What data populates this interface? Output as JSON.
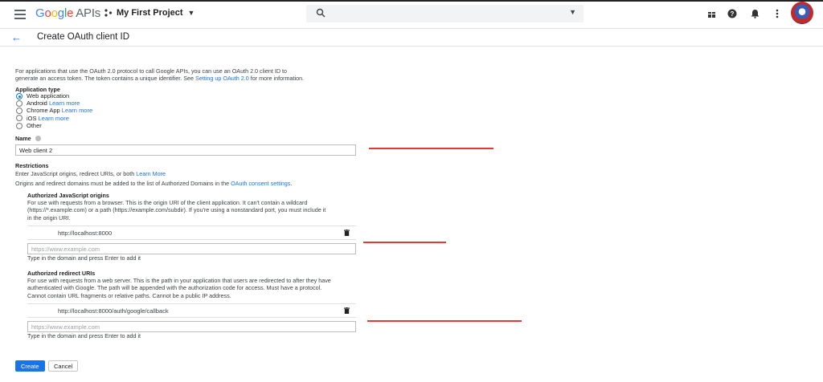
{
  "topbar": {
    "logo_letters": [
      "G",
      "o",
      "o",
      "g",
      "l",
      "e"
    ],
    "logo_suffix": "APIs",
    "project": "My First Project",
    "icons": [
      "menu-icon",
      "project-dots-icon",
      "search-icon",
      "dropdown-caret-icon",
      "gift-icon",
      "help-icon",
      "notifications-icon",
      "more-vert-icon"
    ]
  },
  "page": {
    "title": "Create OAuth client ID"
  },
  "intro": {
    "line1": "For applications that use the OAuth 2.0 protocol to call Google APIs, you can use an OAuth 2.0 client ID to",
    "line2_pre": "generate an access token. The token contains a unique identifier. See ",
    "line2_link": "Setting up OAuth 2.0",
    "line2_post": " for more information."
  },
  "app_type": {
    "label": "Application type",
    "options": [
      {
        "label": "Web application",
        "link": "",
        "selected": true
      },
      {
        "label": "Android",
        "link": "Learn more",
        "selected": false
      },
      {
        "label": "Chrome App",
        "link": "Learn more",
        "selected": false
      },
      {
        "label": "iOS",
        "link": "Learn more",
        "selected": false
      },
      {
        "label": "Other",
        "link": "",
        "selected": false
      }
    ]
  },
  "name": {
    "label": "Name",
    "value": "Web client 2"
  },
  "restrictions": {
    "label": "Restrictions",
    "line1_pre": "Enter JavaScript origins, redirect URIs, or both ",
    "line1_link": "Learn More",
    "line2_pre": "Origins and redirect domains must be added to the list of Authorized Domains in the ",
    "line2_link": "OAuth consent settings",
    "line2_post": "."
  },
  "js_origins": {
    "label": "Authorized JavaScript origins",
    "desc1": "For use with requests from a browser. This is the origin URI of the client application. It can't contain a wildcard",
    "desc2": "(https://*.example.com) or a path (https://example.com/subdir). If you're using a nonstandard port, you must include it",
    "desc3": "in the origin URI.",
    "entry": "http://localhost:8000",
    "placeholder": "https://www.example.com",
    "hint": "Type in the domain and press Enter to add it"
  },
  "redirect_uris": {
    "label": "Authorized redirect URIs",
    "desc1": "For use with requests from a web server. This is the path in your application that users are redirected to after they have",
    "desc2": "authenticated with Google. The path will be appended with the authorization code for access. Must have a protocol.",
    "desc3": "Cannot contain URL fragments or relative paths. Cannot be a public IP address.",
    "entry": "http://localhost:8000/auth/google/callback",
    "placeholder": "https://www.example.com",
    "hint": "Type in the domain and press Enter to add it"
  },
  "actions": {
    "create": "Create",
    "cancel": "Cancel"
  },
  "colors": {
    "accent": "#1a73e8",
    "annotation_red": "#e53935"
  }
}
